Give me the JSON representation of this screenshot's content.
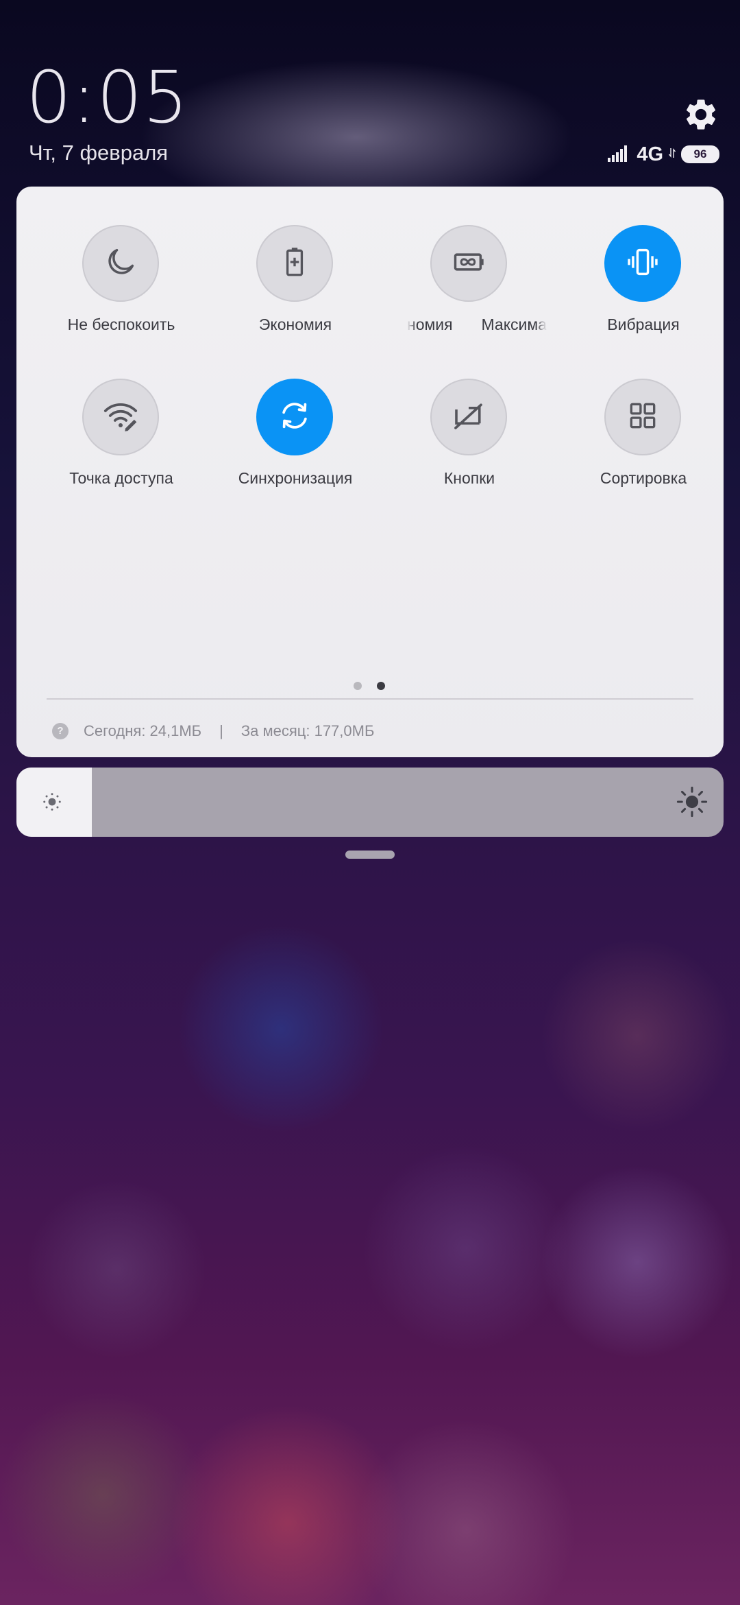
{
  "status": {
    "time": "0:05",
    "date": "Чт, 7 февраля",
    "network_type": "4G",
    "battery_level": "96"
  },
  "tiles": [
    {
      "label": "Не беспокоить",
      "icon": "moon-icon",
      "active": false
    },
    {
      "label": "Экономия",
      "icon": "battery-saver-icon",
      "active": false
    },
    {
      "label": "номия",
      "icon": "ultra-battery-saver-icon",
      "active": false
    },
    {
      "label": "Максима",
      "icon": "ultra-battery-saver-icon",
      "active": false
    },
    {
      "label": "Вибрация",
      "icon": "vibrate-icon",
      "active": true
    },
    {
      "label": "Точка доступа",
      "icon": "hotspot-icon",
      "active": false
    },
    {
      "label": "Синхронизация",
      "icon": "sync-icon",
      "active": true
    },
    {
      "label": "Кнопки",
      "icon": "buttons-off-icon",
      "active": false
    },
    {
      "label": "Сортировка",
      "icon": "grid-icon",
      "active": false
    }
  ],
  "pager": {
    "pages": 2,
    "current": 2
  },
  "data_usage": {
    "help_icon_text": "?",
    "today": "Сегодня: 24,1МБ",
    "separator": "|",
    "month": "За месяц: 177,0МБ"
  },
  "brightness": {
    "level": 0.08
  },
  "colors": {
    "accent": "#0a93f5",
    "tile_inactive": "#dcdbe0",
    "icon_inactive": "#55555c",
    "panel": "#f1f0f3"
  }
}
